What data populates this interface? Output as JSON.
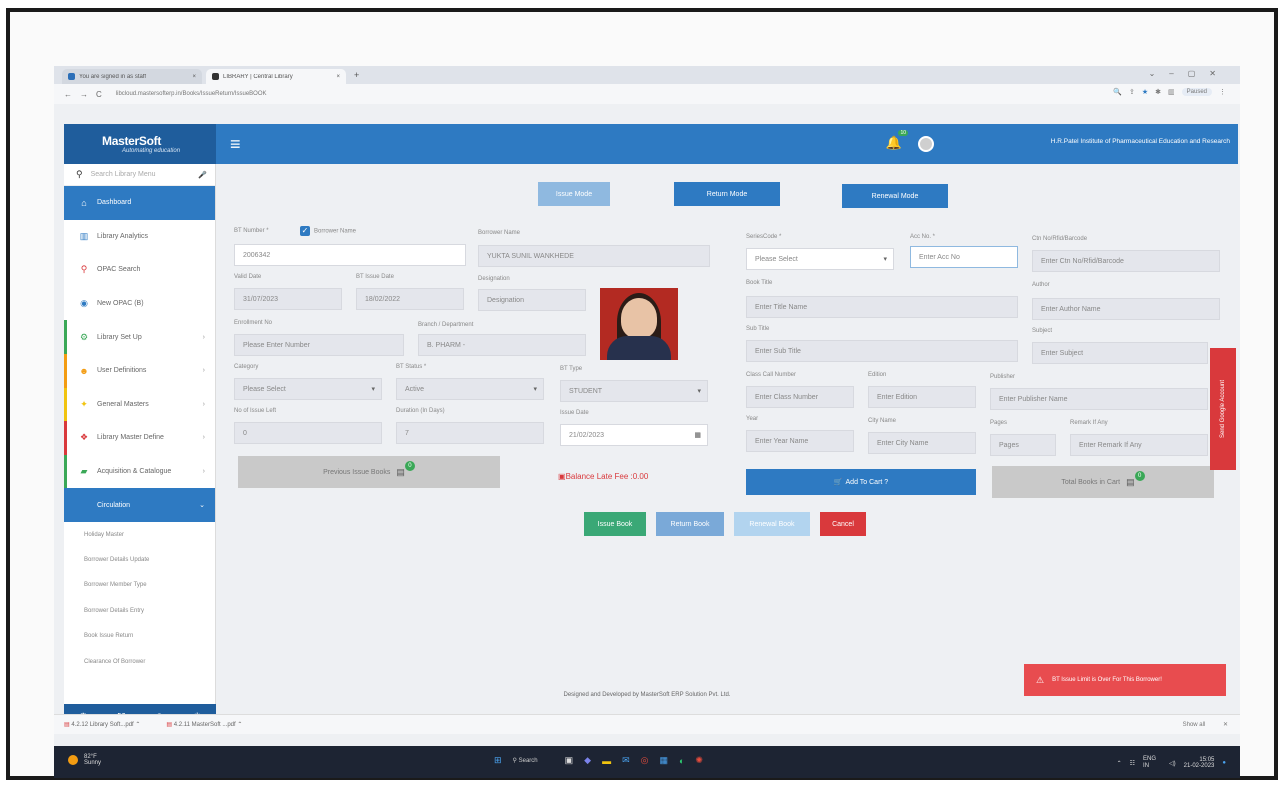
{
  "browser": {
    "tabs": [
      {
        "label": "You are signed in as staff"
      },
      {
        "label": "LIBRARY | Central Library"
      }
    ],
    "new_tab": "+",
    "url": "libcloud.mastersofterp.in/Books/IssueReturn/IssueBOOK",
    "profile_label": "Paused"
  },
  "app": {
    "logo_text": "MasterSoft",
    "logo_tagline": "Automating education",
    "notification_count": "10",
    "institute": "H.R.Patel Institute of Pharmaceutical Education and Research"
  },
  "sidebar": {
    "search_placeholder": "Search Library Menu",
    "items": [
      {
        "label": "Dashboard",
        "icon": "home-icon"
      },
      {
        "label": "Library Analytics",
        "icon": "chart-icon"
      },
      {
        "label": "OPAC Search",
        "icon": "search-icon"
      },
      {
        "label": "New OPAC (B)",
        "icon": "globe-icon"
      },
      {
        "label": "Library Set Up",
        "icon": "gears-icon"
      },
      {
        "label": "User Definitions",
        "icon": "users-icon"
      },
      {
        "label": "General Masters",
        "icon": "star-icon"
      },
      {
        "label": "Library Master Define",
        "icon": "cubes-icon"
      },
      {
        "label": "Acquisition & Catalogue",
        "icon": "book-icon"
      },
      {
        "label": "Circulation",
        "icon": "circulation-icon"
      }
    ],
    "subitems": [
      "Holiday Master",
      "Borrower Details Update",
      "Borrower Member Type",
      "Borrower Details Entry",
      "Book Issue Return",
      "Clearance Of Borrower"
    ]
  },
  "modes": {
    "issue": "Issue Mode",
    "return": "Return Mode",
    "renewal": "Renewal Mode"
  },
  "form": {
    "bt_number_label": "BT Number *",
    "borrower_name_check_label": "Borrower Name",
    "bt_number_value": "2006342",
    "borrower_name_label": "Borrower Name",
    "borrower_name_value": "YUKTA SUNIL WANKHEDE",
    "valid_date_label": "Valid Date",
    "valid_date_value": "31/07/2023",
    "bt_issue_date_label": "BT Issue Date",
    "bt_issue_date_value": "18/02/2022",
    "designation_label": "Designation",
    "designation_value": "Designation",
    "enrollment_label": "Enrollment No",
    "enrollment_placeholder": "Please Enter Number",
    "branch_label": "Branch / Department",
    "branch_value": "B. PHARM -",
    "category_label": "Category",
    "category_value": "Please Select",
    "bt_status_label": "BT Status *",
    "bt_status_value": "Active",
    "bt_type_label": "BT Type",
    "bt_type_value": "STUDENT",
    "no_issue_label": "No of Issue Left",
    "no_issue_value": "0",
    "duration_label": "Duration (In Days)",
    "duration_value": "7",
    "issue_date_label": "Issue Date",
    "issue_date_value": "21/02/2023",
    "previous_issue_books": "Previous Issue Books",
    "balance_fee": "Balance Late Fee :0.00",
    "series_code_label": "SeriesCode *",
    "series_code_value": "Please Select",
    "acc_no_label": "Acc No. *",
    "acc_no_placeholder": "Enter Acc No",
    "ctn_no_label": "Ctn No/Rfid/Barcode",
    "ctn_no_placeholder": "Enter Ctn No/Rfid/Barcode",
    "book_title_label": "Book Title",
    "book_title_placeholder": "Enter Title Name",
    "author_label": "Author",
    "author_placeholder": "Enter Author Name",
    "sub_title_label": "Sub Title",
    "sub_title_placeholder": "Enter Sub Title",
    "subject_label": "Subject",
    "subject_placeholder": "Enter Subject",
    "class_call_label": "Class Call Number",
    "class_call_placeholder": "Enter Class Number",
    "edition_label": "Edition",
    "edition_placeholder": "Enter Edition",
    "publisher_label": "Publisher",
    "publisher_placeholder": "Enter Publisher Name",
    "year_label": "Year",
    "year_placeholder": "Enter Year Name",
    "city_label": "City Name",
    "city_placeholder": "Enter City Name",
    "pages_label": "Pages",
    "pages_placeholder": "Pages",
    "remark_label": "Remark If Any",
    "remark_placeholder": "Enter Remark If Any",
    "add_to_cart": "Add To Cart ?",
    "total_books_in_cart": "Total Books in Cart",
    "cart_count": "0",
    "prev_count": "0"
  },
  "actions": {
    "issue_book": "Issue Book",
    "return_book": "Return Book",
    "renewal_book": "Renewal Book",
    "cancel": "Cancel"
  },
  "side_tab": "Send Google Account",
  "footer": "Designed and Developed by MasterSoft ERP Solution Pvt. Ltd.",
  "alert": "BT Issue Limit is Over For This Borrower!",
  "downloads": {
    "items": [
      "4.2.12 Library Soft...pdf",
      "4.2.11 MasterSoft ...pdf"
    ],
    "show_all": "Show all"
  },
  "taskbar": {
    "temperature": "82°F",
    "weather": "Sunny",
    "search": "Search",
    "lang": "ENG IN",
    "time": "15:05",
    "date": "21-02-2023"
  },
  "colors": {
    "primary": "#2e7ac2",
    "issue_btn": "#3aa876",
    "cancel_btn": "#d9393c",
    "alert": "#e84c4f"
  }
}
